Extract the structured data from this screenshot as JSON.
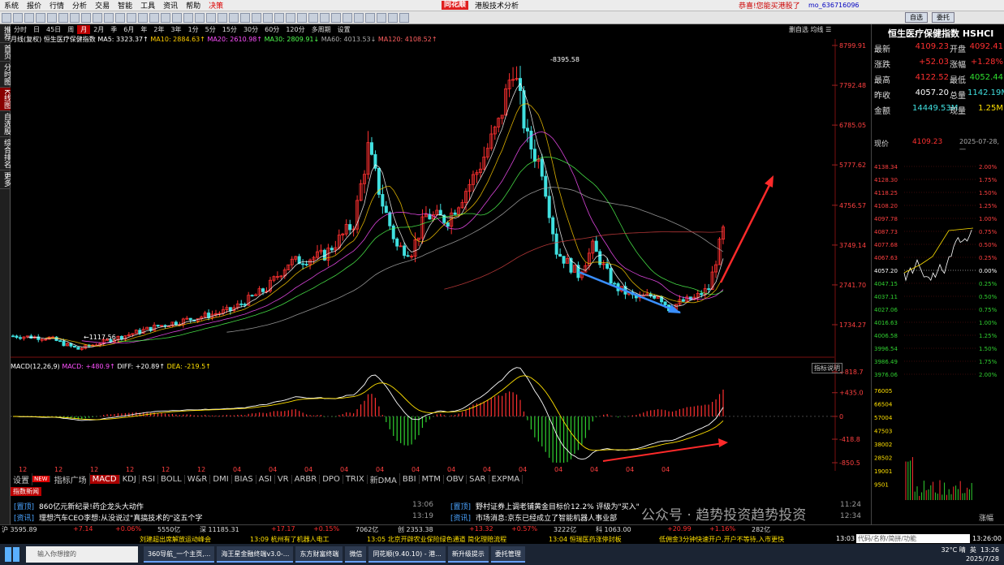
{
  "menu": {
    "items": [
      "系统",
      "报价",
      "行情",
      "分析",
      "交易",
      "智能",
      "工具",
      "资讯",
      "帮助"
    ],
    "jc": "决策",
    "brand": "同花顺",
    "title": "港股技术分析",
    "notice": "恭喜!您能买港股了",
    "user": "mo_636716096",
    "btn1": "自选",
    "btn2": "委托"
  },
  "nav": [
    "推荐",
    "首页",
    "分时图",
    "K线图",
    "自选股",
    "综合排名",
    "更多"
  ],
  "periods": [
    "分时",
    "日",
    "45日",
    "周",
    "月",
    "2月",
    "季",
    "6月",
    "年",
    "2年",
    "3年",
    "1分",
    "5分",
    "15分",
    "30分",
    "60分",
    "120分",
    "多周期",
    "设置"
  ],
  "period_active": "月",
  "period_right": "删自选 均线 ☰",
  "ma": {
    "label": "月线(复权)",
    "name": "恒生医疗保健指数",
    "ma5": "MA5: 3323.37↑",
    "ma10": "MA10: 2884.63↑",
    "ma20": "MA20: 2610.98↑",
    "ma30": "MA30: 2809.91↓",
    "ma60": "MA60: 4013.53↓",
    "ma120": "MA120: 4108.52↑"
  },
  "macd": {
    "title": "MACD(12,26,9)",
    "macd": "MACD: +480.9↑",
    "diff": "DIFF: +20.89↑",
    "dea": "DEA: -219.5↑",
    "help": "指标说明"
  },
  "tabs": [
    "设置",
    "指标广场",
    "MACD",
    "KDJ",
    "RSI",
    "BOLL",
    "W&R",
    "DMI",
    "BIAS",
    "ASI",
    "VR",
    "ARBR",
    "DPO",
    "TRIX",
    "新DMA",
    "BBI",
    "MTM",
    "OBV",
    "SAR",
    "EXPMA"
  ],
  "tab_new": "NEW",
  "tab_active": "MACD",
  "chart_data": {
    "type": "candlestick",
    "main": {
      "y_ticks": [
        "8799.91",
        "7792.48",
        "6785.05",
        "5777.62",
        "4756.57",
        "3749.14",
        "2741.70",
        "1734.27"
      ],
      "high_label": "8395.58",
      "low_label": "1117.56",
      "x_ticks": [
        "12",
        "12",
        "12",
        "12",
        "12",
        "12",
        "04",
        "04",
        "04",
        "04",
        "04",
        "04",
        "04",
        "04",
        "04",
        "04",
        "04",
        "04",
        "04"
      ]
    },
    "macd": {
      "y_ticks": [
        "+818.7",
        "+435.0",
        "0",
        "-418.8",
        "-850.5"
      ]
    }
  },
  "news": {
    "header": "指数新闻",
    "items": [
      {
        "tag": "[置顶]",
        "text": "860亿元新纪录!药企龙头大动作",
        "time": "13:06"
      },
      {
        "tag": "[资讯]",
        "text": "理想汽车CEO李想:从没说过\"真搞技术的\"这五个字",
        "time": "13:19"
      },
      {
        "tag": "[置顶]",
        "text": "野村证券上调老铺黄金目标价12.2% 评级为\"买入\"",
        "time": "11:24"
      },
      {
        "tag": "[资讯]",
        "text": "市场消息:京东已经成立了智能机器人事业部",
        "time": "12:34"
      }
    ]
  },
  "quote": {
    "title": "恒生医疗保健指数 HSHCI",
    "rows": [
      [
        "最新",
        "4109.23",
        "开盘",
        "4092.41"
      ],
      [
        "涨跌",
        "+52.03",
        "涨幅",
        "+1.28%"
      ],
      [
        "最高",
        "4122.52",
        "最低",
        "4052.44"
      ],
      [
        "昨收",
        "4057.20",
        "总量",
        "1142.19M"
      ],
      [
        "金额",
        "14449.53M",
        "现量",
        "1.25M"
      ]
    ],
    "now_label": "现价",
    "now_val": "4109.23",
    "date": "2025-07-28,一",
    "price_ticks": [
      "4138.34",
      "4128.30",
      "4118.25",
      "4108.20",
      "4097.78",
      "4087.73",
      "4077.68",
      "4067.63",
      "4057.20",
      "4047.15",
      "4037.11",
      "4027.06",
      "4016.63",
      "4006.58",
      "3996.54",
      "3986.49",
      "3976.06"
    ],
    "pct_ticks": [
      "2.00%",
      "1.75%",
      "1.50%",
      "1.25%",
      "1.00%",
      "0.75%",
      "0.50%",
      "0.25%",
      "0.00%",
      "0.25%",
      "0.50%",
      "0.75%",
      "1.00%",
      "1.25%",
      "1.50%",
      "1.75%",
      "2.00%"
    ],
    "vol_ticks": [
      "76005",
      "66504",
      "57004",
      "47503",
      "38002",
      "28502",
      "19001",
      "9501"
    ],
    "bottom": "涨幅"
  },
  "ticker1": [
    "沪 3595.89",
    "+7.14",
    "+0.06%",
    "5550亿",
    "深 11185.31",
    "+17.17",
    "+0.15%",
    "7062亿",
    "创 2353.38",
    "+13.32",
    "+0.57%",
    "3222亿",
    "科 1063.00",
    "+20.99",
    "+1.16%",
    "282亿"
  ],
  "ticker2": [
    "刘建超出席解放运动峰会",
    "13:09 杭州有了机器人电工",
    "13:05 北京开辟农业保险绿色通道 简化理赔流程",
    "13:04 恒瑞医药涨停封板",
    "低佣金3分钟快速开户,开户不等待,入市更快"
  ],
  "ticker_time": "13:03",
  "search_ph": "代码/名称/简拼/功能",
  "clock": "13:26:00",
  "taskbar": {
    "search": "输入你想搜的",
    "tasks": [
      "360导航_一个主页,...",
      "海王星金融终端v3.0-...",
      "东方财富终端",
      "微信",
      "同花顺(9.40.10) - 港...",
      "新升级提示",
      "委托管理"
    ],
    "weather": "32°C 晴",
    "time": "13:26",
    "date": "2025/7/28",
    "ime": "英"
  },
  "watermark": "公众号 · 趋势投资趋势投资",
  "colors": {
    "up": "#ff3030",
    "down": "#40e0e0",
    "accent": "#e02020"
  }
}
